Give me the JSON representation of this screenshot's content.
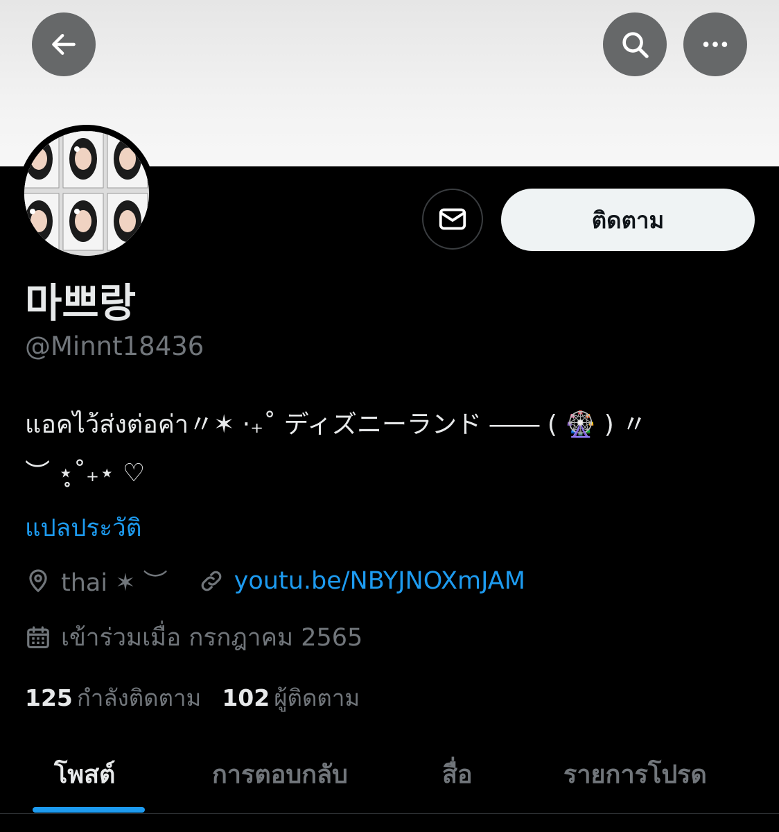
{
  "header": {
    "back_icon": "arrow-left-icon",
    "search_icon": "search-icon",
    "more_icon": "more-horizontal-icon",
    "button_color": "#666869"
  },
  "profile": {
    "display_name": "마쁘랑",
    "handle": "@Minnt18436",
    "bio_line1": "แอคไว้ส่งต่อค่า〃✶ ⋅₊˚ ディズニーランド ―― ( 🎡 ) 〃",
    "bio_line2": "︶ ⋆̥˚₊⋆ ♡",
    "translate_label": "แปลประวัติ",
    "location": "thai ✶ ︶",
    "website": "youtu.be/NBYJNOXmJAM",
    "joined": "เข้าร่วมเมื่อ กรกฎาคม 2565",
    "message_icon": "mail-icon",
    "follow_label": "ติดตาม"
  },
  "stats": {
    "following_count": "125",
    "following_label": "กำลังติดตาม",
    "followers_count": "102",
    "followers_label": "ผู้ติดตาม"
  },
  "tabs": [
    {
      "label": "โพสต์",
      "active": true
    },
    {
      "label": "การตอบกลับ",
      "active": false
    },
    {
      "label": "สื่อ",
      "active": false
    },
    {
      "label": "รายการโปรด",
      "active": false
    }
  ],
  "colors": {
    "accent": "#1d9bf0",
    "background": "#000000",
    "secondary_text": "#71767b",
    "primary_text": "#e7e9ea"
  }
}
